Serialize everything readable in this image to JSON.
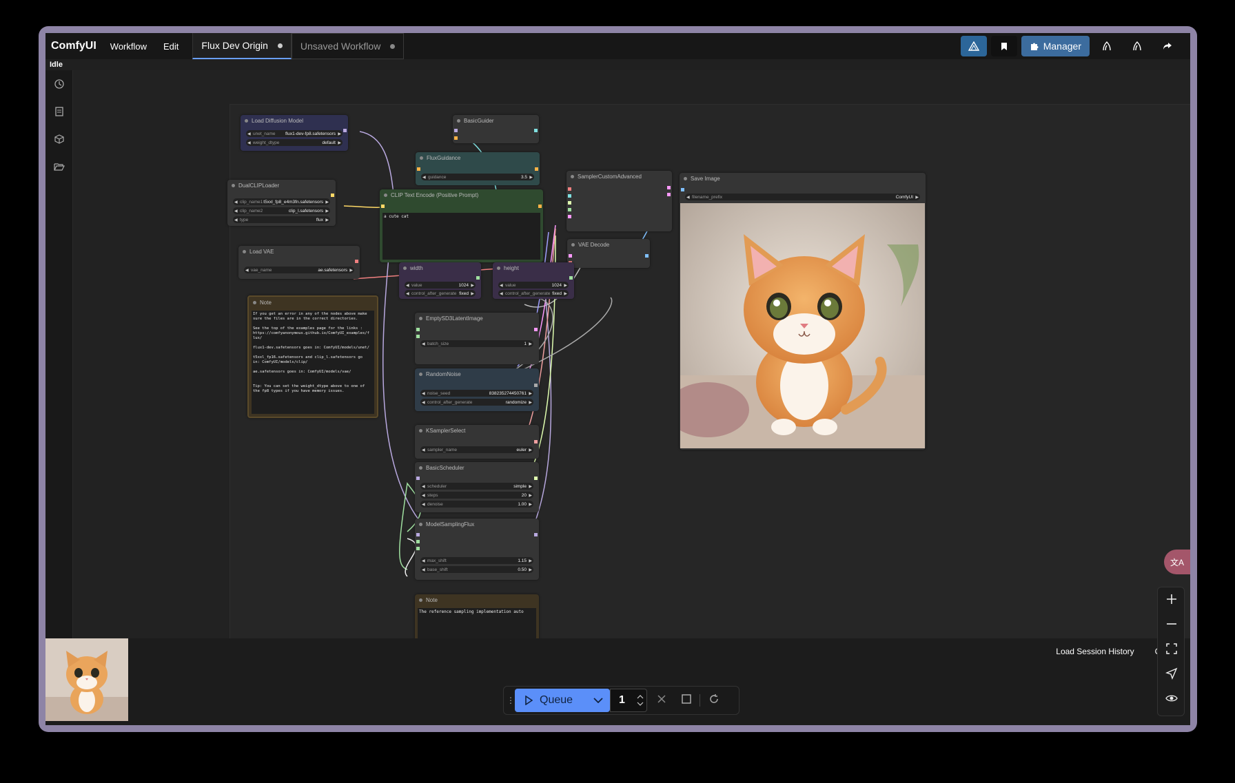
{
  "app": {
    "name": "ComfyUI",
    "status": "Idle"
  },
  "menu": {
    "workflow": "Workflow",
    "edit": "Edit"
  },
  "tabs": [
    {
      "label": "Flux Dev Origin"
    },
    {
      "label": "Unsaved Workflow"
    }
  ],
  "toolbar": {
    "manager": "Manager"
  },
  "nodes": {
    "load_diffusion": {
      "title": "Load Diffusion Model",
      "w1_label": "unet_name",
      "w1_value": "flux1-dev-fp8.safetensors",
      "w2_label": "weight_dtype",
      "w2_value": "default"
    },
    "dualclip": {
      "title": "DualCLIPLoader",
      "w1_label": "clip_name1",
      "w1_value": "t5xxl_fp8_e4m3fn.safetensors",
      "w2_label": "clip_name2",
      "w2_value": "clip_l.safetensors",
      "w3_label": "type",
      "w3_value": "flux"
    },
    "load_vae": {
      "title": "Load VAE",
      "w1_label": "vae_name",
      "w1_value": "ae.safetensors"
    },
    "basic_guider": {
      "title": "BasicGuider"
    },
    "flux_guidance": {
      "title": "FluxGuidance",
      "w1_label": "guidance",
      "w1_value": "3.5"
    },
    "clip_text": {
      "title": "CLIP Text Encode (Positive Prompt)",
      "text": "a cute cat"
    },
    "sampler_custom": {
      "title": "SamplerCustomAdvanced"
    },
    "vae_decode": {
      "title": "VAE Decode"
    },
    "save_image": {
      "title": "Save Image",
      "w1_label": "filename_prefix",
      "w1_value": "ComfyUI"
    },
    "width": {
      "title": "width",
      "w1_label": "value",
      "w1_value": "1024",
      "w2_label": "control_after_generate",
      "w2_value": "fixed"
    },
    "height": {
      "title": "height",
      "w1_label": "value",
      "w1_value": "1024",
      "w2_label": "control_after_generate",
      "w2_value": "fixed"
    },
    "note1": {
      "title": "Note",
      "text": "If you get an error in any of the nodes above make\nsure the files are in the correct directories.\n\nSee the top of the examples page for the links :\nhttps://comfyanonymous.github.io/ComfyUI_examples/f\nlux/\n\nflux1-dev.safetensors goes in: ComfyUI/models/unet/\n\nt5xxl_fp16.safetensors and clip_l.safetensors go\nin: ComfyUI/models/clip/\n\nae.safetensors goes in: ComfyUI/models/vae/\n\n\nTip: You can set the weight_dtype above to one of\nthe fp8 types if you have memory issues."
    },
    "empty_latent": {
      "title": "EmptySD3LatentImage",
      "w1_label": "batch_size",
      "w1_value": "1"
    },
    "random_noise": {
      "title": "RandomNoise",
      "w1_label": "noise_seed",
      "w1_value": "838235274450761",
      "w2_label": "control_after_generate",
      "w2_value": "randomize"
    },
    "ksampler_select": {
      "title": "KSamplerSelect",
      "w1_label": "sampler_name",
      "w1_value": "euler"
    },
    "basic_scheduler": {
      "title": "BasicScheduler",
      "w1_label": "scheduler",
      "w1_value": "simple",
      "w2_label": "steps",
      "w2_value": "20",
      "w3_label": "denoise",
      "w3_value": "1.00"
    },
    "model_sampling": {
      "title": "ModelSamplingFlux",
      "w1_label": "max_shift",
      "w1_value": "1.15",
      "w2_label": "base_shift",
      "w2_value": "0.50"
    },
    "note2": {
      "title": "Note",
      "text": "The reference sampling implementation auto"
    }
  },
  "bottom": {
    "load_history": "Load Session History",
    "clear": "Cl"
  },
  "queue": {
    "label": "Queue",
    "count": "1"
  },
  "colors": {
    "accent": "#5b8ff9",
    "manager": "#3c6c9e",
    "window_frame": "#8e84a6"
  }
}
